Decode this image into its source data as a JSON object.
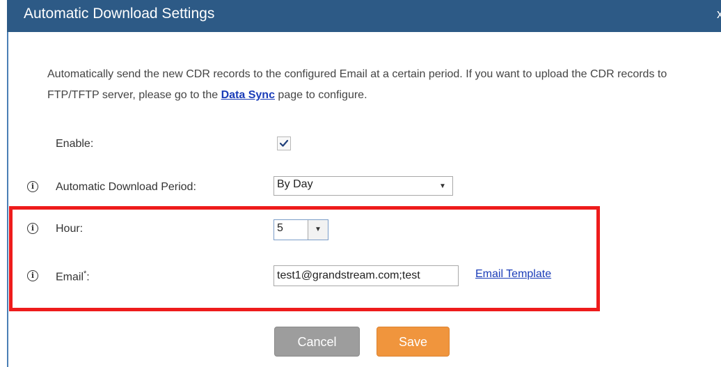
{
  "dialog": {
    "title": "Automatic Download Settings",
    "close_label": "x"
  },
  "description": {
    "text_before_link": "Automatically send the new CDR records to the configured Email at a certain period. If you want to upload the CDR records to FTP/TFTP server, please go to the ",
    "link_text": "Data Sync",
    "text_after_link": " page to configure."
  },
  "form": {
    "enable_label": "Enable:",
    "enable_checked": true,
    "period_label": "Automatic Download Period:",
    "period_value": "By Day",
    "hour_label": "Hour:",
    "hour_value": "5",
    "email_label": "Email",
    "email_required_mark": "*",
    "email_label_suffix": ":",
    "email_value": "test1@grandstream.com;test",
    "email_template_link": "Email Template",
    "info_icon_glyph": "i"
  },
  "buttons": {
    "cancel_label": "Cancel",
    "save_label": "Save"
  },
  "colors": {
    "titlebar": "#2d5a86",
    "highlight_box": "#ee1c1c",
    "save_button": "#f0953d",
    "cancel_button": "#9d9d9d",
    "link": "#1a3cb8"
  }
}
